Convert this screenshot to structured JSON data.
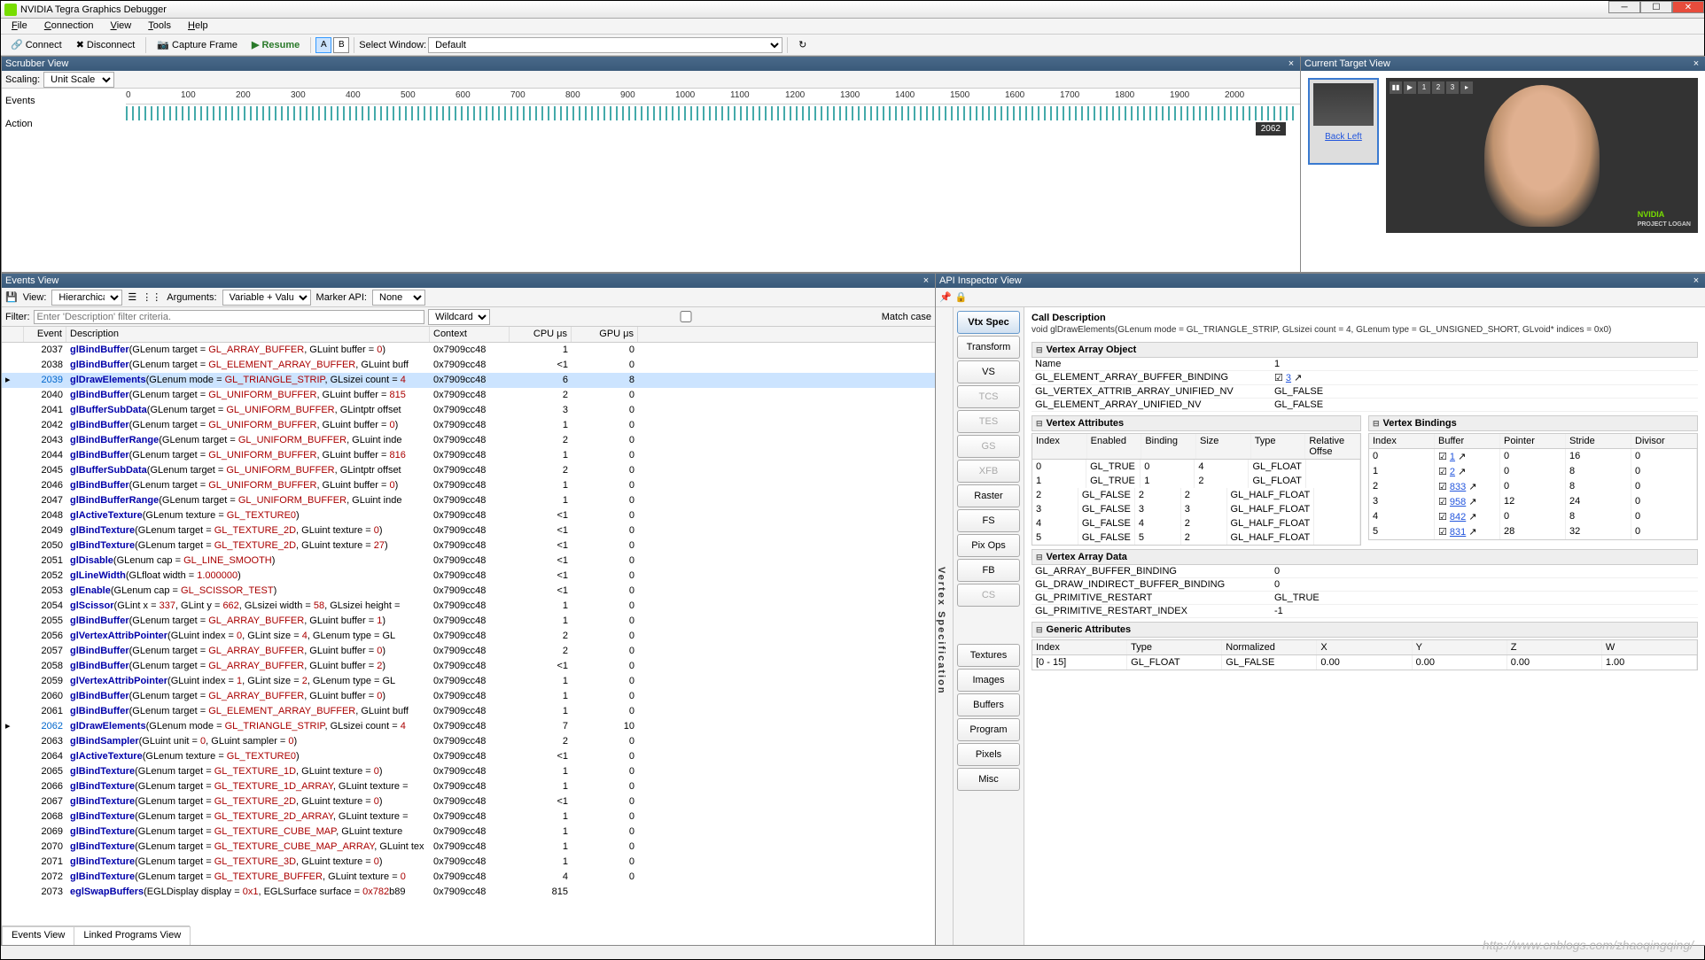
{
  "window": {
    "title": "NVIDIA Tegra Graphics Debugger"
  },
  "menu": [
    "File",
    "Connection",
    "View",
    "Tools",
    "Help"
  ],
  "toolbar": {
    "connect": "Connect",
    "disconnect": "Disconnect",
    "capture": "Capture Frame",
    "resume": "Resume",
    "select_window": "Select Window:",
    "select_window_value": "Default"
  },
  "scrubber": {
    "title": "Scrubber View",
    "scaling_lbl": "Scaling:",
    "scaling_value": "Unit Scale",
    "row_events": "Events",
    "row_action": "Action",
    "ticks": [
      "0",
      "100",
      "200",
      "300",
      "400",
      "500",
      "600",
      "700",
      "800",
      "900",
      "1000",
      "1100",
      "1200",
      "1300",
      "1400",
      "1500",
      "1600",
      "1700",
      "1800",
      "1900",
      "2000"
    ],
    "end": "2062"
  },
  "current_target": {
    "title": "Current Target View",
    "thumb_link": "Back Left",
    "preview_nums": [
      "1",
      "2",
      "3"
    ]
  },
  "events": {
    "title": "Events View",
    "view_lbl": "View:",
    "view_value": "Hierarchical",
    "args_lbl": "Arguments:",
    "args_value": "Variable + Value",
    "marker_lbl": "Marker API:",
    "marker_value": "None",
    "filter_lbl": "Filter:",
    "filter_ph": "Enter 'Description' filter criteria.",
    "wildcard": "Wildcard",
    "matchcase": "Match case",
    "cols": {
      "event": "Event",
      "desc": "Description",
      "ctx": "Context",
      "cpu": "CPU μs",
      "gpu": "GPU μs"
    },
    "ctx": "0x7909cc48",
    "rows": [
      {
        "id": 2037,
        "fn": "glBindBuffer",
        "args": "(GLenum target = GL_ARRAY_BUFFER, GLuint buffer = 0)",
        "cpu": "1",
        "gpu": "0"
      },
      {
        "id": 2038,
        "fn": "glBindBuffer",
        "args": "(GLenum target = GL_ELEMENT_ARRAY_BUFFER, GLuint buff",
        "cpu": "<1",
        "gpu": "0"
      },
      {
        "id": 2039,
        "sel": true,
        "fn": "glDrawElements",
        "args": "(GLenum mode = GL_TRIANGLE_STRIP, GLsizei count = 4",
        "cpu": "6",
        "gpu": "8"
      },
      {
        "id": 2040,
        "fn": "glBindBuffer",
        "args": "(GLenum target = GL_UNIFORM_BUFFER, GLuint buffer = 815",
        "cpu": "2",
        "gpu": "0"
      },
      {
        "id": 2041,
        "fn": "glBufferSubData",
        "args": "(GLenum target = GL_UNIFORM_BUFFER, GLintptr offset",
        "cpu": "3",
        "gpu": "0"
      },
      {
        "id": 2042,
        "fn": "glBindBuffer",
        "args": "(GLenum target = GL_UNIFORM_BUFFER, GLuint buffer = 0)",
        "cpu": "1",
        "gpu": "0"
      },
      {
        "id": 2043,
        "fn": "glBindBufferRange",
        "args": "(GLenum target = GL_UNIFORM_BUFFER, GLuint inde",
        "cpu": "2",
        "gpu": "0"
      },
      {
        "id": 2044,
        "fn": "glBindBuffer",
        "args": "(GLenum target = GL_UNIFORM_BUFFER, GLuint buffer = 816",
        "cpu": "1",
        "gpu": "0"
      },
      {
        "id": 2045,
        "fn": "glBufferSubData",
        "args": "(GLenum target = GL_UNIFORM_BUFFER, GLintptr offset",
        "cpu": "2",
        "gpu": "0"
      },
      {
        "id": 2046,
        "fn": "glBindBuffer",
        "args": "(GLenum target = GL_UNIFORM_BUFFER, GLuint buffer = 0)",
        "cpu": "1",
        "gpu": "0"
      },
      {
        "id": 2047,
        "fn": "glBindBufferRange",
        "args": "(GLenum target = GL_UNIFORM_BUFFER, GLuint inde",
        "cpu": "1",
        "gpu": "0"
      },
      {
        "id": 2048,
        "fn": "glActiveTexture",
        "args": "(GLenum texture = GL_TEXTURE0)",
        "cpu": "<1",
        "gpu": "0"
      },
      {
        "id": 2049,
        "fn": "glBindTexture",
        "args": "(GLenum target = GL_TEXTURE_2D, GLuint texture = 0)",
        "cpu": "<1",
        "gpu": "0"
      },
      {
        "id": 2050,
        "fn": "glBindTexture",
        "args": "(GLenum target = GL_TEXTURE_2D, GLuint texture = 27)",
        "cpu": "<1",
        "gpu": "0"
      },
      {
        "id": 2051,
        "fn": "glDisable",
        "args": "(GLenum cap = GL_LINE_SMOOTH)",
        "cpu": "<1",
        "gpu": "0"
      },
      {
        "id": 2052,
        "fn": "glLineWidth",
        "args": "(GLfloat width = 1.000000)",
        "cpu": "<1",
        "gpu": "0"
      },
      {
        "id": 2053,
        "fn": "glEnable",
        "args": "(GLenum cap = GL_SCISSOR_TEST)",
        "cpu": "<1",
        "gpu": "0"
      },
      {
        "id": 2054,
        "fn": "glScissor",
        "args": "(GLint x = 337, GLint y = 662, GLsizei width = 58, GLsizei height =",
        "cpu": "1",
        "gpu": "0"
      },
      {
        "id": 2055,
        "fn": "glBindBuffer",
        "args": "(GLenum target = GL_ARRAY_BUFFER, GLuint buffer = 1)",
        "cpu": "1",
        "gpu": "0"
      },
      {
        "id": 2056,
        "fn": "glVertexAttribPointer",
        "args": "(GLuint index = 0, GLint size = 4, GLenum type = GL",
        "cpu": "2",
        "gpu": "0"
      },
      {
        "id": 2057,
        "fn": "glBindBuffer",
        "args": "(GLenum target = GL_ARRAY_BUFFER, GLuint buffer = 0)",
        "cpu": "2",
        "gpu": "0"
      },
      {
        "id": 2058,
        "fn": "glBindBuffer",
        "args": "(GLenum target = GL_ARRAY_BUFFER, GLuint buffer = 2)",
        "cpu": "<1",
        "gpu": "0"
      },
      {
        "id": 2059,
        "fn": "glVertexAttribPointer",
        "args": "(GLuint index = 1, GLint size = 2, GLenum type = GL",
        "cpu": "1",
        "gpu": "0"
      },
      {
        "id": 2060,
        "fn": "glBindBuffer",
        "args": "(GLenum target = GL_ARRAY_BUFFER, GLuint buffer = 0)",
        "cpu": "1",
        "gpu": "0"
      },
      {
        "id": 2061,
        "fn": "glBindBuffer",
        "args": "(GLenum target = GL_ELEMENT_ARRAY_BUFFER, GLuint buff",
        "cpu": "1",
        "gpu": "0"
      },
      {
        "id": 2062,
        "hl": true,
        "fn": "glDrawElements",
        "args": "(GLenum mode = GL_TRIANGLE_STRIP, GLsizei count = 4",
        "cpu": "7",
        "gpu": "10"
      },
      {
        "id": 2063,
        "fn": "glBindSampler",
        "args": "(GLuint unit = 0, GLuint sampler = 0)",
        "cpu": "2",
        "gpu": "0"
      },
      {
        "id": 2064,
        "fn": "glActiveTexture",
        "args": "(GLenum texture = GL_TEXTURE0)",
        "cpu": "<1",
        "gpu": "0"
      },
      {
        "id": 2065,
        "fn": "glBindTexture",
        "args": "(GLenum target = GL_TEXTURE_1D, GLuint texture = 0)",
        "cpu": "1",
        "gpu": "0"
      },
      {
        "id": 2066,
        "fn": "glBindTexture",
        "args": "(GLenum target = GL_TEXTURE_1D_ARRAY, GLuint texture =",
        "cpu": "1",
        "gpu": "0"
      },
      {
        "id": 2067,
        "fn": "glBindTexture",
        "args": "(GLenum target = GL_TEXTURE_2D, GLuint texture = 0)",
        "cpu": "<1",
        "gpu": "0"
      },
      {
        "id": 2068,
        "fn": "glBindTexture",
        "args": "(GLenum target = GL_TEXTURE_2D_ARRAY, GLuint texture =",
        "cpu": "1",
        "gpu": "0"
      },
      {
        "id": 2069,
        "fn": "glBindTexture",
        "args": "(GLenum target = GL_TEXTURE_CUBE_MAP, GLuint texture",
        "cpu": "1",
        "gpu": "0"
      },
      {
        "id": 2070,
        "fn": "glBindTexture",
        "args": "(GLenum target = GL_TEXTURE_CUBE_MAP_ARRAY, GLuint tex",
        "cpu": "1",
        "gpu": "0"
      },
      {
        "id": 2071,
        "fn": "glBindTexture",
        "args": "(GLenum target = GL_TEXTURE_3D, GLuint texture = 0)",
        "cpu": "1",
        "gpu": "0"
      },
      {
        "id": 2072,
        "fn": "glBindTexture",
        "args": "(GLenum target = GL_TEXTURE_BUFFER, GLuint texture = 0",
        "cpu": "4",
        "gpu": "0"
      },
      {
        "id": 2073,
        "fn": "eglSwapBuffers",
        "args": "(EGLDisplay display = 0x1, EGLSurface surface = 0x782b89",
        "cpu": "815",
        "gpu": ""
      }
    ],
    "tabs": [
      "Events View",
      "Linked Programs View"
    ]
  },
  "api": {
    "title": "API Inspector View",
    "vtx_label": "Vertex Specification",
    "stages": [
      "Vtx Spec",
      "Transform",
      "VS",
      "TCS",
      "TES",
      "GS",
      "XFB",
      "Raster",
      "FS",
      "Pix Ops",
      "FB",
      "CS"
    ],
    "stages2": [
      "Textures",
      "Images",
      "Buffers",
      "Program",
      "Pixels",
      "Misc"
    ],
    "call_desc_t": "Call Description",
    "call_desc": "void glDrawElements(GLenum mode = GL_TRIANGLE_STRIP, GLsizei count = 4, GLenum type = GL_UNSIGNED_SHORT, GLvoid* indices = 0x0)",
    "vao_t": "Vertex Array Object",
    "vao": [
      {
        "k": "Name",
        "v": "1"
      },
      {
        "k": "GL_ELEMENT_ARRAY_BUFFER_BINDING",
        "v": "3",
        "link": true
      },
      {
        "k": "GL_VERTEX_ATTRIB_ARRAY_UNIFIED_NV",
        "v": "GL_FALSE"
      },
      {
        "k": "GL_ELEMENT_ARRAY_UNIFIED_NV",
        "v": "GL_FALSE"
      }
    ],
    "va_t": "Vertex Attributes",
    "va_cols": [
      "Index",
      "Enabled",
      "Binding",
      "Size",
      "Type",
      "Relative Offse"
    ],
    "va_rows": [
      [
        "0",
        "GL_TRUE",
        "0",
        "4",
        "GL_FLOAT",
        ""
      ],
      [
        "1",
        "GL_TRUE",
        "1",
        "2",
        "GL_FLOAT",
        ""
      ],
      [
        "2",
        "GL_FALSE",
        "2",
        "2",
        "GL_HALF_FLOAT",
        ""
      ],
      [
        "3",
        "GL_FALSE",
        "3",
        "3",
        "GL_HALF_FLOAT",
        ""
      ],
      [
        "4",
        "GL_FALSE",
        "4",
        "2",
        "GL_HALF_FLOAT",
        ""
      ],
      [
        "5",
        "GL_FALSE",
        "5",
        "2",
        "GL_HALF_FLOAT",
        ""
      ]
    ],
    "vb_t": "Vertex Bindings",
    "vb_cols": [
      "Index",
      "Buffer",
      "Pointer",
      "Stride",
      "Divisor"
    ],
    "vb_rows": [
      [
        "0",
        "1",
        "0",
        "16",
        "0"
      ],
      [
        "1",
        "2",
        "0",
        "8",
        "0"
      ],
      [
        "2",
        "833",
        "0",
        "8",
        "0"
      ],
      [
        "3",
        "958",
        "12",
        "24",
        "0"
      ],
      [
        "4",
        "842",
        "0",
        "8",
        "0"
      ],
      [
        "5",
        "831",
        "28",
        "32",
        "0"
      ]
    ],
    "vad_t": "Vertex Array Data",
    "vad": [
      {
        "k": "GL_ARRAY_BUFFER_BINDING",
        "v": "0"
      },
      {
        "k": "GL_DRAW_INDIRECT_BUFFER_BINDING",
        "v": "0"
      },
      {
        "k": "GL_PRIMITIVE_RESTART",
        "v": "GL_TRUE"
      },
      {
        "k": "GL_PRIMITIVE_RESTART_INDEX",
        "v": "-1"
      }
    ],
    "ga_t": "Generic Attributes",
    "ga_cols": [
      "Index",
      "Type",
      "Normalized",
      "X",
      "Y",
      "Z",
      "W"
    ],
    "ga_row": [
      "[0 - 15]",
      "GL_FLOAT",
      "GL_FALSE",
      "0.00",
      "0.00",
      "0.00",
      "1.00"
    ]
  },
  "watermark": "http://www.cnblogs.com/zhaoqingqing/"
}
